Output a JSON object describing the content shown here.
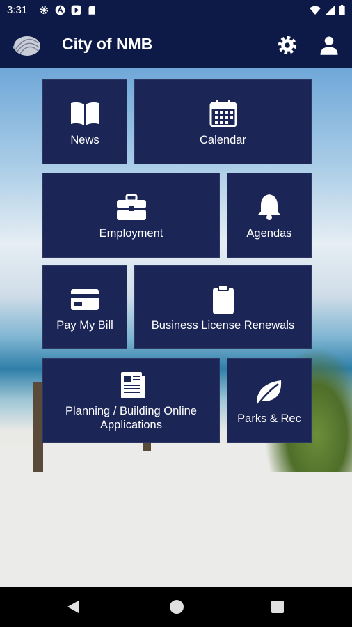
{
  "status_bar": {
    "time": "3:31",
    "icons": [
      "gear-icon",
      "a-badge-icon",
      "play-icon",
      "sd-card-icon"
    ],
    "right_icons": [
      "wifi-icon",
      "signal-icon",
      "battery-icon"
    ]
  },
  "app_bar": {
    "title": "City of NMB",
    "logo": "shell-logo",
    "actions": [
      "settings-icon",
      "account-icon"
    ]
  },
  "colors": {
    "bar": "#0d1a47",
    "tile": "#1b2556",
    "text": "#ffffff"
  },
  "tiles": [
    {
      "label": "News",
      "icon": "book-icon"
    },
    {
      "label": "Calendar",
      "icon": "calendar-icon"
    },
    {
      "label": "Employment",
      "icon": "briefcase-icon"
    },
    {
      "label": "Agendas",
      "icon": "bell-icon"
    },
    {
      "label": "Pay My Bill",
      "icon": "credit-card-icon"
    },
    {
      "label": "Business License Renewals",
      "icon": "clipboard-icon"
    },
    {
      "label": "Planning / Building Online Applications",
      "icon": "newspaper-icon"
    },
    {
      "label": "Parks & Rec",
      "icon": "leaf-icon"
    }
  ],
  "nav_bar": [
    "back-button",
    "home-button",
    "recents-button"
  ]
}
